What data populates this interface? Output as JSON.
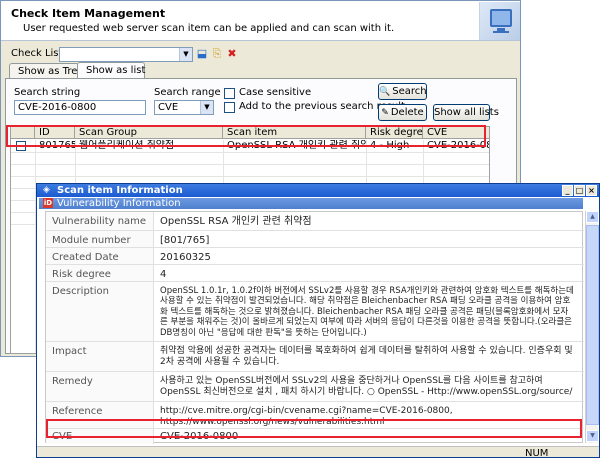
{
  "main": {
    "title": "Check Item Management",
    "subtitle": "User requested web server scan item can be applied and can scan with it.",
    "checklist_label": "Check List",
    "checklist_value": "",
    "tabs": [
      "Show as Tree",
      "Show as list"
    ],
    "search": {
      "label": "Search string",
      "value": "CVE-2016-0800",
      "range_label": "Search range",
      "range_value": "CVE",
      "case_sensitive": "Case sensitive",
      "add_previous": "Add to the previous search result",
      "search_button": "Search",
      "delete_button": "Delete",
      "show_all_button": "Show all lists"
    },
    "table": {
      "columns": [
        "ID",
        "Scan Group",
        "Scan item",
        "Risk degree",
        "CVE"
      ],
      "rows": [
        [
          "801765",
          "웹어플리케이션 취약점",
          "OpenSSL RSA 개인키 관련 취약점",
          "4 - High",
          "CVE-2016-0800"
        ]
      ]
    }
  },
  "dialog": {
    "title": "Scan item Information",
    "subtitle": "Vulnerability Information",
    "rows": [
      {
        "label": "Vulnerability name",
        "value": "OpenSSL RSA 개인키 관련 취약점"
      },
      {
        "label": "Module number",
        "value": "[801/765]"
      },
      {
        "label": "Created Date",
        "value": "20160325"
      },
      {
        "label": "Risk degree",
        "value": "4"
      },
      {
        "label": "Description",
        "value": "OpenSSL 1.0.1r, 1.0.2f이하 버전에서 SSLv2를 사용할 경우 RSA개인키와 관련하여 암호화 텍스트를 해독하는데 사용할 수 있는 취약점이 발견되었습니다. 해당 취약점은 Bleichenbacher RSA 패딩 오라클 공격을 이용하여 암호화 텍스트를 해독하는 것으로 밝혀졌습니다. Bleichenbacher RSA 패딩 오라클 공격은 패딩(블록암호화에서 모자른 부분을 채워주는 것)이 올바르게 되었는지 여부에 따라 서버의 응답이 다른것을 이용한 공격을 뜻합니다.(오라클은 DB명칭이 아닌 \"응답에 대한 판독\"을 뜻하는 단어입니다.)"
      },
      {
        "label": "Impact",
        "value": "취약점 악용에 성공한 공격자는 데이터를 복호화하여 쉽게 데이터를 탈취하여 사용할 수 있습니다. 인증우회 및 2차 공격에 사용될 수 있습니다."
      },
      {
        "label": "Remedy",
        "value": "사용하고 있는 OpenSSL버전에서 SSLv2의 사용을 중단하거나 OpenSSL를 다음 사이트를 참고하여 OpenSSL 최신버전으로 설치 , 패치 하시기 바랍니다. ○ OpenSSL - Http://www.openSSL.org/source/"
      },
      {
        "label": "Reference",
        "value": "http://cve.mitre.org/cgi-bin/cvename.cgi?name=CVE-2016-0800,\nhttps://www.openssl.org/news/vulnerabilities.html"
      },
      {
        "label": "CVE",
        "value": "CVE-2016-0800"
      }
    ],
    "status": "NUM"
  },
  "colors": {
    "highlight": "#e8222e",
    "titlebar": "#1b5bd1"
  }
}
